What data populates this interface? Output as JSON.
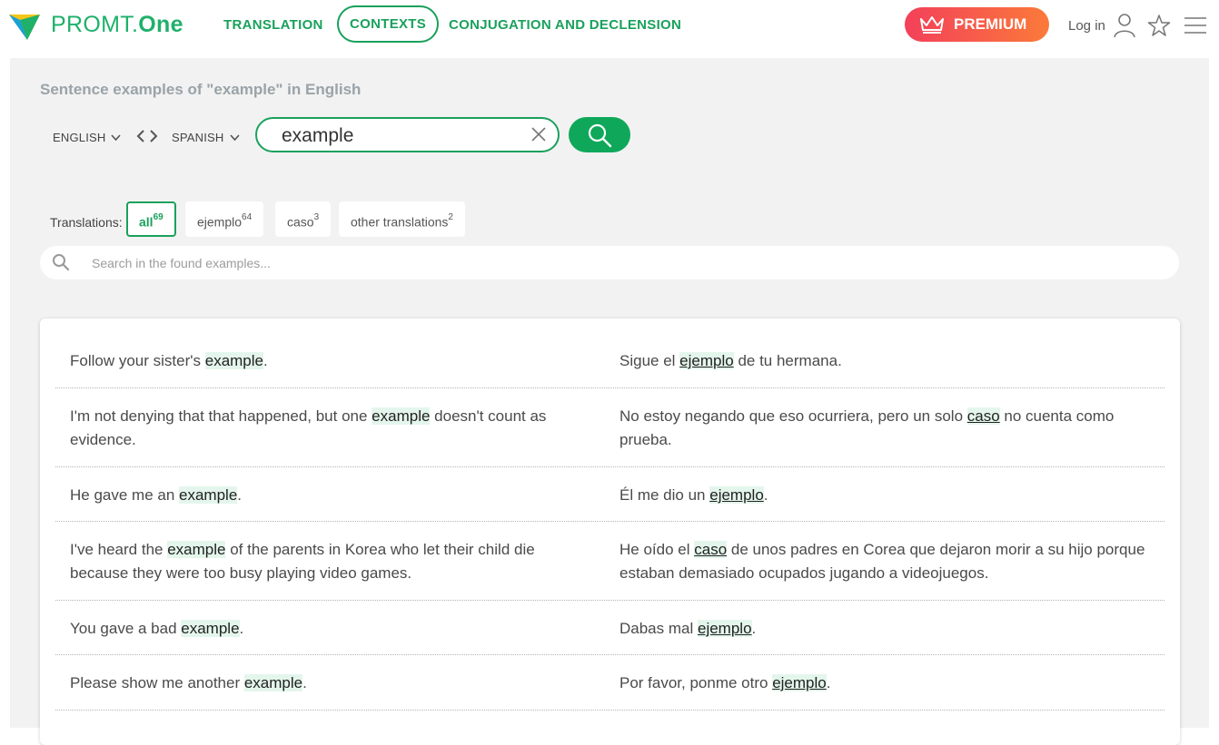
{
  "brand": {
    "name_light": "PROMT.",
    "name_bold": "One"
  },
  "nav": {
    "translation": "TRANSLATION",
    "contexts": "CONTEXTS",
    "conjugation": "CONJUGATION AND DECLENSION"
  },
  "header": {
    "premium": "PREMIUM",
    "login": "Log in"
  },
  "page": {
    "subtitle": "Sentence examples of \"example\" in English"
  },
  "search": {
    "source_lang": "ENGLISH",
    "target_lang": "SPANISH",
    "query": "example"
  },
  "translations": {
    "label": "Translations:",
    "chips": [
      {
        "label": "all",
        "count": "69"
      },
      {
        "label": "ejemplo",
        "count": "64"
      },
      {
        "label": "caso",
        "count": "3"
      },
      {
        "label": "other translations",
        "count": "2"
      }
    ]
  },
  "filter": {
    "placeholder": "Search in the found examples..."
  },
  "examples": [
    {
      "en": {
        "pre": "Follow your sister's ",
        "hl": "example",
        "post": "."
      },
      "es": {
        "pre": "Sigue el ",
        "hl": "ejemplo",
        "post": " de tu hermana."
      }
    },
    {
      "en": {
        "pre": "I'm not denying that that happened, but one ",
        "hl": "example",
        "post": " doesn't count as evidence."
      },
      "es": {
        "pre": "No estoy negando que eso ocurriera, pero un solo ",
        "hl": "caso",
        "post": " no cuenta como prueba."
      }
    },
    {
      "en": {
        "pre": "He gave me an ",
        "hl": "example",
        "post": "."
      },
      "es": {
        "pre": "Él me dio un ",
        "hl": "ejemplo",
        "post": "."
      }
    },
    {
      "en": {
        "pre": "I've heard the ",
        "hl": "example",
        "post": " of the parents in Korea who let their child die because they were too busy playing video games."
      },
      "es": {
        "pre": "He oído el ",
        "hl": "caso",
        "post": " de unos padres en Corea que dejaron morir a su hijo porque estaban demasiado ocupados jugando a videojuegos."
      }
    },
    {
      "en": {
        "pre": "You gave a bad ",
        "hl": "example",
        "post": "."
      },
      "es": {
        "pre": "Dabas mal ",
        "hl": "ejemplo",
        "post": "."
      }
    },
    {
      "en": {
        "pre": "Please show me another ",
        "hl": "example",
        "post": "."
      },
      "es": {
        "pre": "Por favor, ponme otro ",
        "hl": "ejemplo",
        "post": "."
      }
    }
  ],
  "colors": {
    "accent": "#19a15c",
    "highlight": "#e4f6ec",
    "panel": "#f2f2f2"
  }
}
